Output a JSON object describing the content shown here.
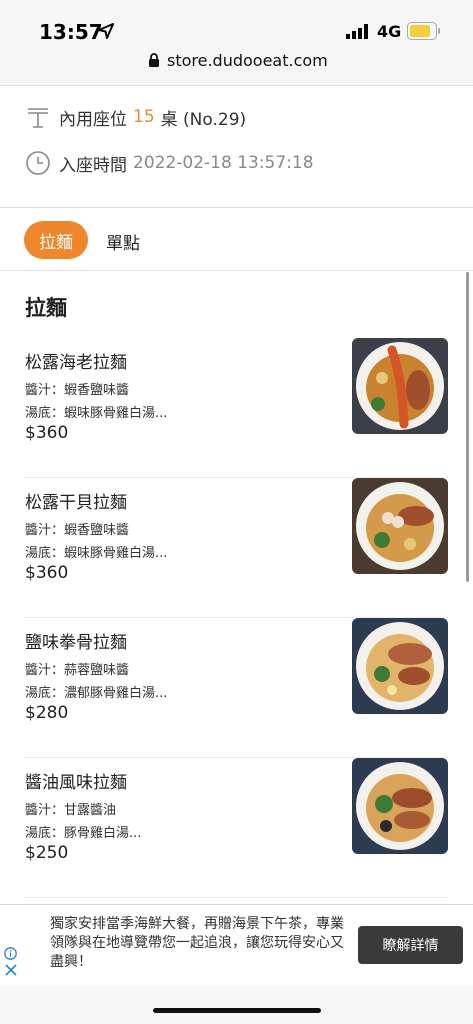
{
  "status_bar": {
    "time": "13:57",
    "network": "4G"
  },
  "browser": {
    "url": "store.dudooeat.com"
  },
  "seat": {
    "table_label": "內用座位",
    "table_number": "15",
    "table_suffix": "桌 (No.29)",
    "time_label": "入座時間",
    "time_value": "2022-02-18 13:57:18"
  },
  "tabs": [
    {
      "label": "拉麵",
      "active": true
    },
    {
      "label": "單點",
      "active": false
    }
  ],
  "section_title": "拉麵",
  "items": [
    {
      "name": "松露海老拉麵",
      "sauce": "醬汁：蝦香鹽味醬",
      "soup": "湯底：蝦味豚骨雞白湯...",
      "price": "$360"
    },
    {
      "name": "松露干貝拉麵",
      "sauce": "醬汁：蝦香鹽味醬",
      "soup": "湯底：蝦味豚骨雞白湯...",
      "price": "$360"
    },
    {
      "name": "鹽味拳骨拉麵",
      "sauce": "醬汁：蒜蓉鹽味醬",
      "soup": "湯底：濃郁豚骨雞白湯...",
      "price": "$280"
    },
    {
      "name": "醬油風味拉麵",
      "sauce": "醬汁：甘露醬油",
      "soup": "湯底：豚骨雞白湯...",
      "price": "$250"
    }
  ],
  "ad": {
    "text": "獨家安排當季海鮮大餐，再贈海景下午茶，專業領隊與在地導覽帶您一起追浪，讓您玩得安心又盡興！",
    "button": "瞭解詳情"
  },
  "colors": {
    "accent": "#f0862c",
    "ad_button": "#3a3a3a"
  }
}
